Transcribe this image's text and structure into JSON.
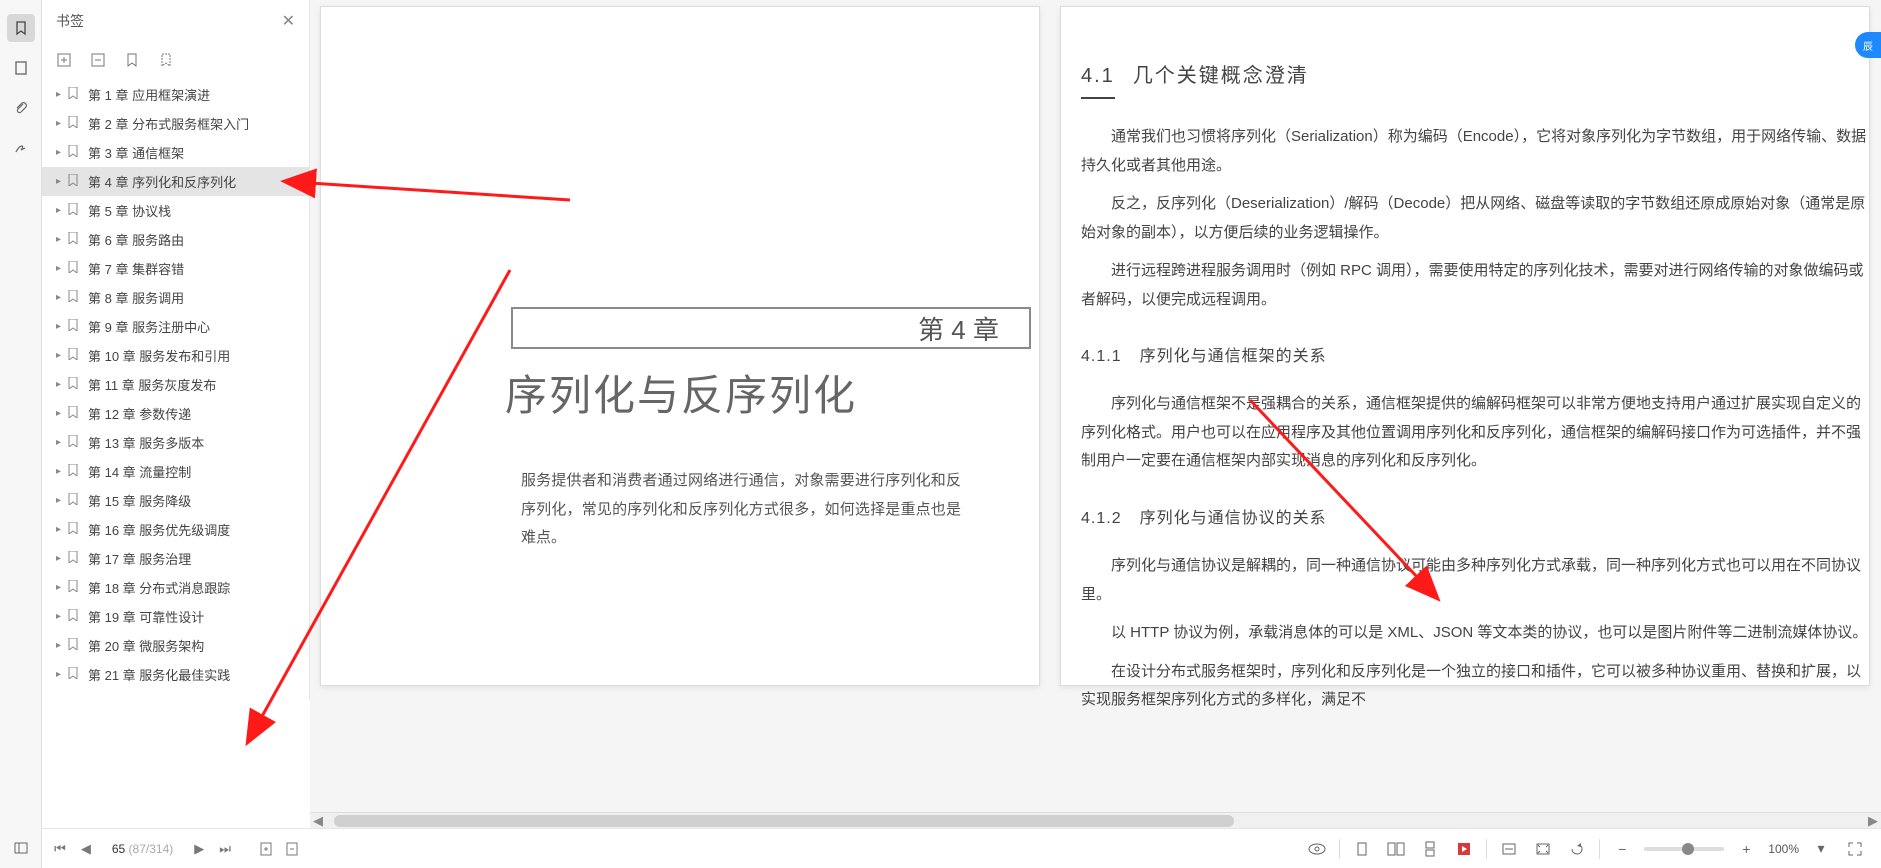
{
  "sidebar": {
    "title": "书签",
    "items": [
      {
        "label": "第 1 章 应用框架演进"
      },
      {
        "label": "第 2 章 分布式服务框架入门"
      },
      {
        "label": "第 3 章 通信框架"
      },
      {
        "label": "第 4 章 序列化和反序列化"
      },
      {
        "label": "第 5 章 协议栈"
      },
      {
        "label": "第 6 章 服务路由"
      },
      {
        "label": "第 7 章 集群容错"
      },
      {
        "label": "第 8 章 服务调用"
      },
      {
        "label": "第 9 章 服务注册中心"
      },
      {
        "label": "第 10 章 服务发布和引用"
      },
      {
        "label": "第 11 章 服务灰度发布"
      },
      {
        "label": "第 12 章 参数传递"
      },
      {
        "label": "第 13 章 服务多版本"
      },
      {
        "label": "第 14 章 流量控制"
      },
      {
        "label": "第 15 章 服务降级"
      },
      {
        "label": "第 16 章 服务优先级调度"
      },
      {
        "label": "第 17 章 服务治理"
      },
      {
        "label": "第 18 章 分布式消息跟踪"
      },
      {
        "label": "第 19 章 可靠性设计"
      },
      {
        "label": "第 20 章 微服务架构"
      },
      {
        "label": "第 21 章 服务化最佳实践"
      }
    ],
    "selected_index": 3
  },
  "page_nav": {
    "current": "65",
    "range": "(87/314)"
  },
  "bottom_bar": {
    "zoom": "100%"
  },
  "doc": {
    "left_page": {
      "chapter_num": "第 4 章",
      "chapter_title": "序列化与反序列化",
      "intro": "服务提供者和消费者通过网络进行通信，对象需要进行序列化和反序列化，常见的序列化和反序列化方式很多，如何选择是重点也是难点。"
    },
    "right_page": {
      "h1_num": "4.1",
      "h1_title": "几个关键概念澄清",
      "p1": "通常我们也习惯将序列化（Serialization）称为编码（Encode），它将对象序列化为字节数组，用于网络传输、数据持久化或者其他用途。",
      "p2": "反之，反序列化（Deserialization）/解码（Decode）把从网络、磁盘等读取的字节数组还原成原始对象（通常是原始对象的副本），以方便后续的业务逻辑操作。",
      "p3": "进行远程跨进程服务调用时（例如 RPC 调用），需要使用特定的序列化技术，需要对进行网络传输的对象做编码或者解码，以便完成远程调用。",
      "h2a_num": "4.1.1",
      "h2a_title": "序列化与通信框架的关系",
      "p4": "序列化与通信框架不是强耦合的关系，通信框架提供的编解码框架可以非常方便地支持用户通过扩展实现自定义的序列化格式。用户也可以在应用程序及其他位置调用序列化和反序列化，通信框架的编解码接口作为可选插件，并不强制用户一定要在通信框架内部实现消息的序列化和反序列化。",
      "h2b_num": "4.1.2",
      "h2b_title": "序列化与通信协议的关系",
      "p5": "序列化与通信协议是解耦的，同一种通信协议可能由多种序列化方式承载，同一种序列化方式也可以用在不同协议里。",
      "p6": "以 HTTP 协议为例，承载消息体的可以是 XML、JSON 等文本类的协议，也可以是图片附件等二进制流媒体协议。",
      "p7": "在设计分布式服务框架时，序列化和反序列化是一个独立的接口和插件，它可以被多种协议重用、替换和扩展，以实现服务框架序列化方式的多样化，满足不"
    }
  }
}
